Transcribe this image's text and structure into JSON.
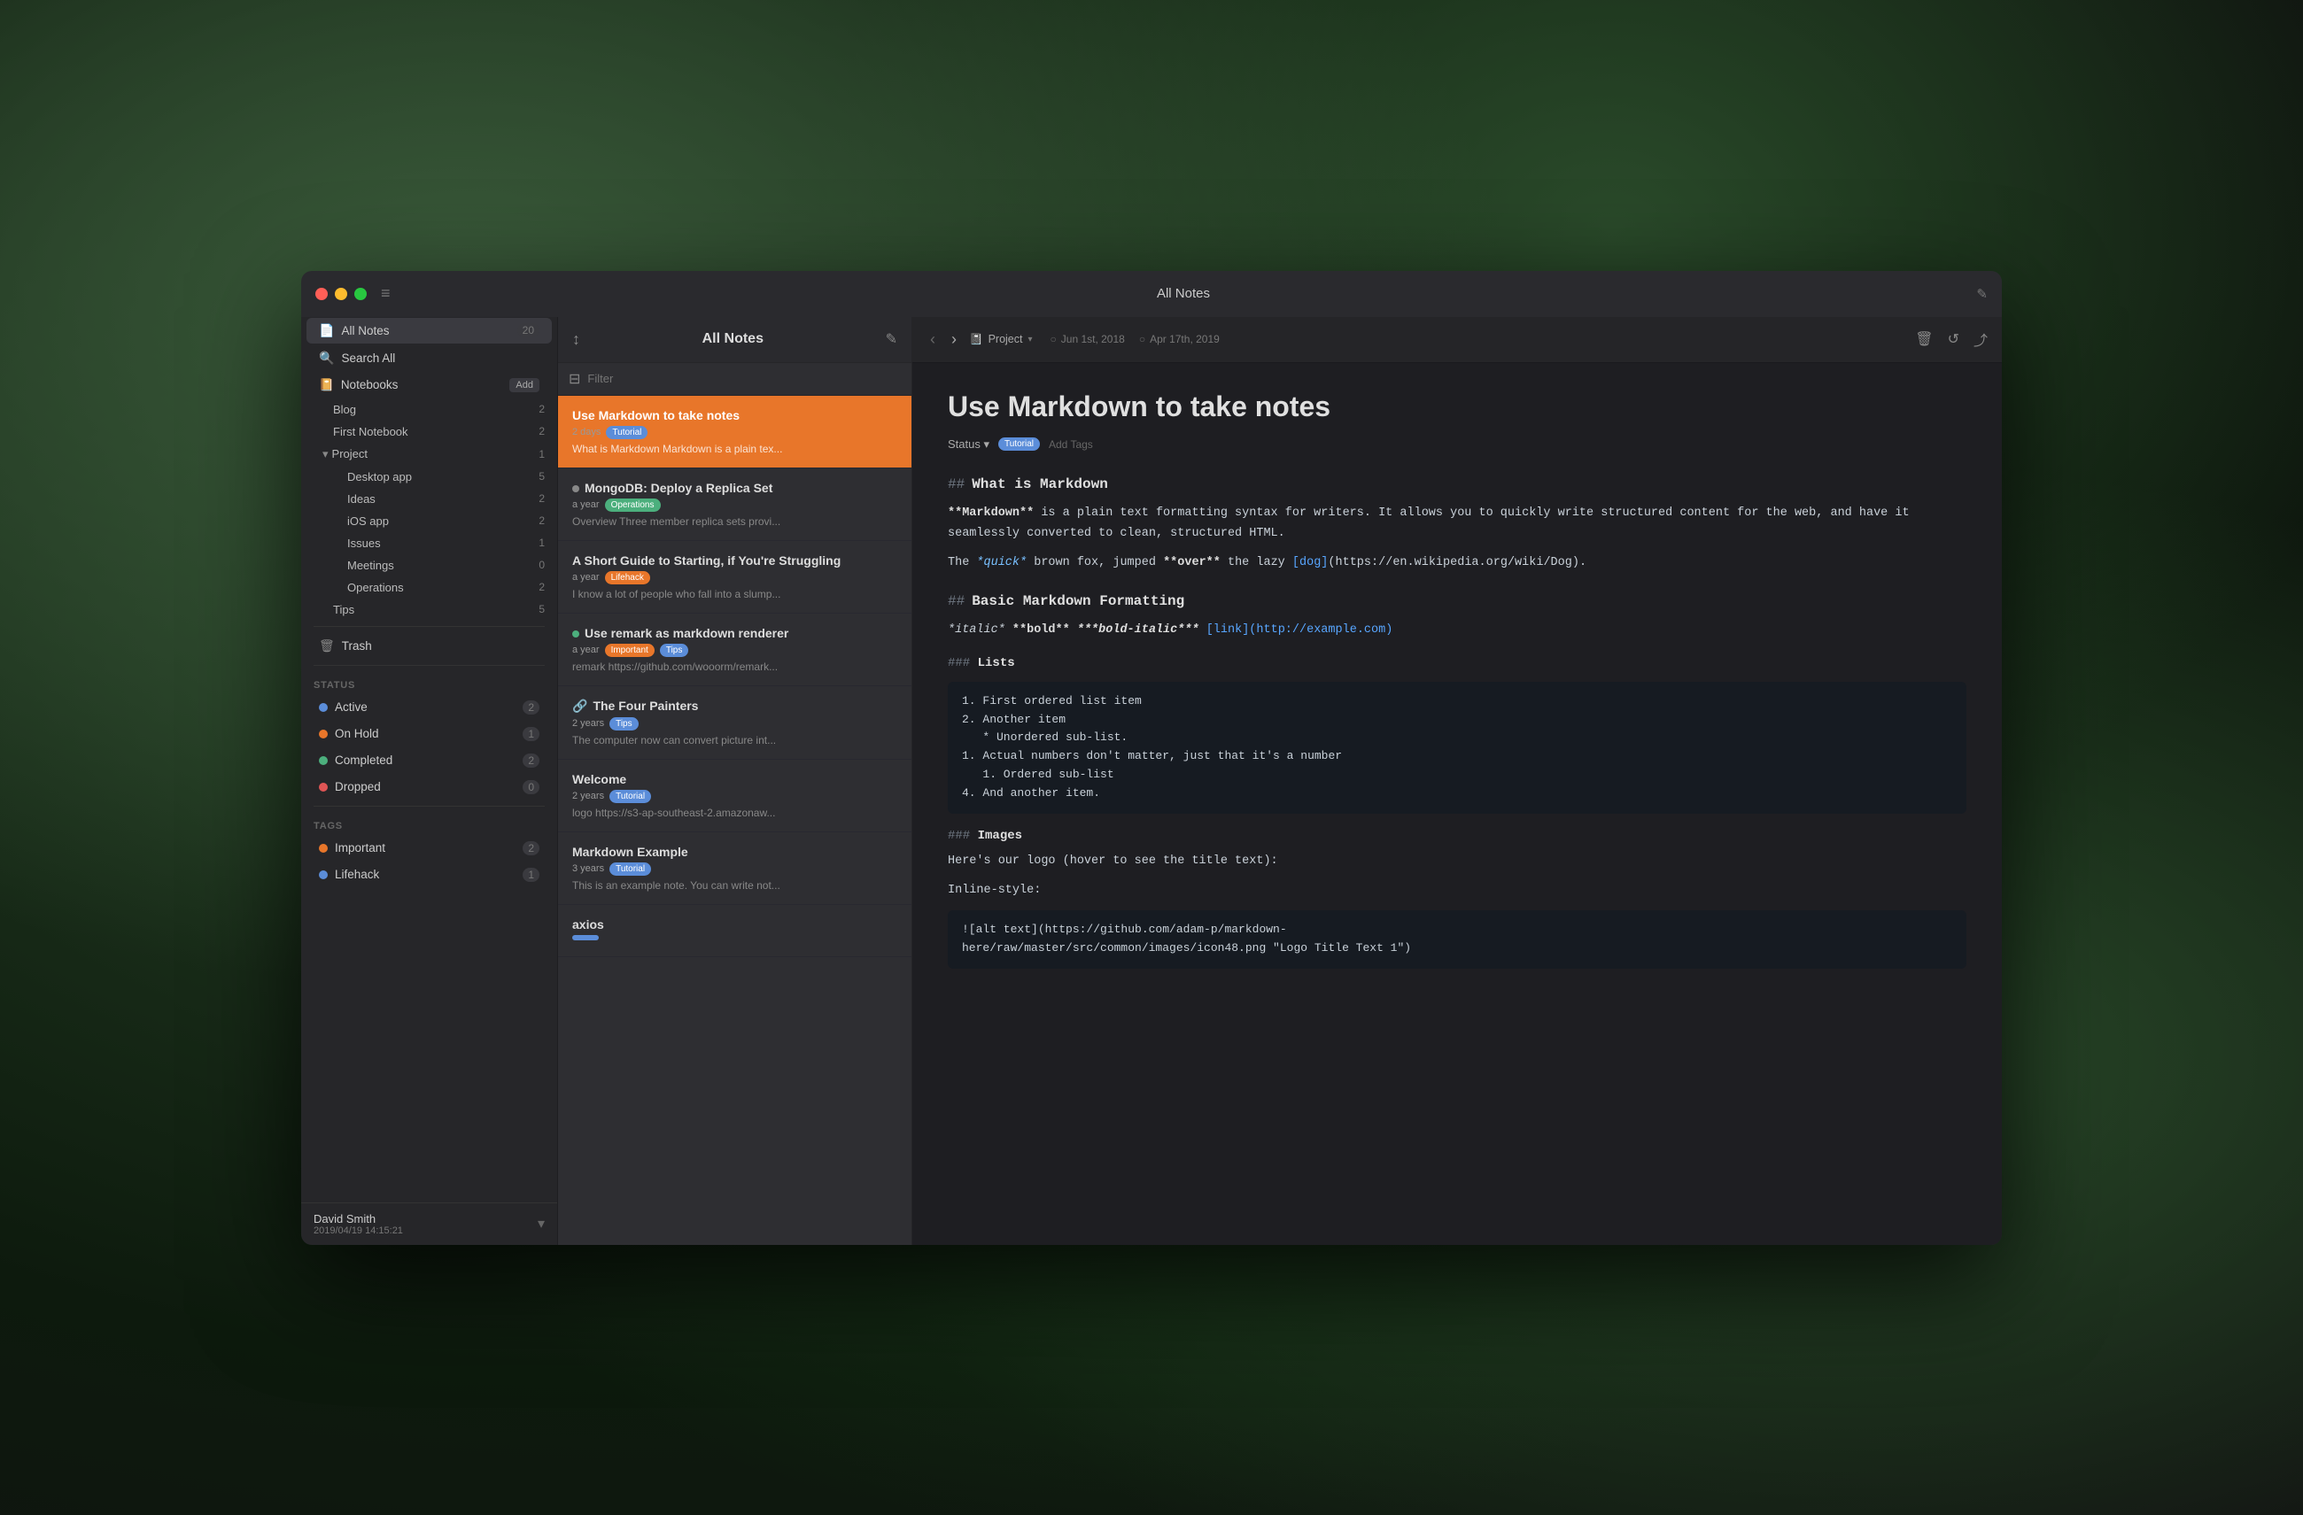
{
  "window": {
    "title": "All Notes",
    "traffic_lights": [
      "red",
      "yellow",
      "green"
    ]
  },
  "sidebar": {
    "all_notes_label": "All Notes",
    "all_notes_count": "20",
    "search_label": "Search All",
    "notebooks_label": "Notebooks",
    "notebooks_add": "Add",
    "notebooks_items": [
      {
        "label": "Blog",
        "count": "2"
      },
      {
        "label": "First Notebook",
        "count": "2"
      },
      {
        "label": "Project",
        "count": "1",
        "expanded": true,
        "children": [
          {
            "label": "Desktop app",
            "count": "5"
          },
          {
            "label": "Ideas",
            "count": "2"
          },
          {
            "label": "iOS app",
            "count": "2"
          },
          {
            "label": "Issues",
            "count": "1"
          },
          {
            "label": "Meetings",
            "count": "0"
          },
          {
            "label": "Operations",
            "count": "2"
          }
        ]
      },
      {
        "label": "Tips",
        "count": "5"
      }
    ],
    "trash_label": "Trash",
    "status_label": "Status",
    "status_items": [
      {
        "label": "Active",
        "count": "2",
        "color": "#5b8dd9"
      },
      {
        "label": "On Hold",
        "count": "1",
        "color": "#e8762a"
      },
      {
        "label": "Completed",
        "count": "2",
        "color": "#4caf7d"
      },
      {
        "label": "Dropped",
        "count": "0",
        "color": "#e05555"
      }
    ],
    "tags_label": "Tags",
    "tags_items": [
      {
        "label": "Important",
        "count": "2",
        "color": "#e8762a"
      },
      {
        "label": "Lifehack",
        "count": "1",
        "color": "#5b8dd9"
      }
    ],
    "user_name": "David Smith",
    "user_date": "2019/04/19 14:15:21"
  },
  "note_list": {
    "title": "All Notes",
    "filter_placeholder": "Filter",
    "sort_icon": "sort",
    "compose_icon": "compose",
    "notes": [
      {
        "id": 1,
        "title": "Use Markdown to take notes",
        "age": "2 days",
        "tags": [
          "Tutorial"
        ],
        "preview": "What is Markdown Markdown is a plain tex...",
        "selected": true
      },
      {
        "id": 2,
        "title": "MongoDB: Deploy a Replica Set",
        "age": "a year",
        "tags": [
          "Operations"
        ],
        "preview": "Overview Three member replica sets provi...",
        "icon_type": "circle",
        "selected": false
      },
      {
        "id": 3,
        "title": "A Short Guide to Starting, if You're Struggling",
        "age": "a year",
        "tags": [
          "Lifehack"
        ],
        "preview": "I know a lot of people who fall into a slump...",
        "selected": false
      },
      {
        "id": 4,
        "title": "Use remark as markdown renderer",
        "age": "a year",
        "tags": [
          "Important",
          "Tips"
        ],
        "preview": "remark https://github.com/wooorm/remark...",
        "icon_type": "check",
        "selected": false
      },
      {
        "id": 5,
        "title": "The Four Painters",
        "age": "2 years",
        "tags": [
          "Tips"
        ],
        "preview": "The computer now can convert picture int...",
        "icon_type": "link",
        "selected": false
      },
      {
        "id": 6,
        "title": "Welcome",
        "age": "2 years",
        "tags": [
          "Tutorial"
        ],
        "preview": "logo https://s3-ap-southeast-2.amazonaw...",
        "selected": false
      },
      {
        "id": 7,
        "title": "Markdown Example",
        "age": "3 years",
        "tags": [
          "Tutorial"
        ],
        "preview": "This is an example note. You can write not...",
        "selected": false
      },
      {
        "id": 8,
        "title": "axios",
        "age": "",
        "tags": [],
        "preview": "",
        "selected": false
      }
    ]
  },
  "editor": {
    "breadcrumb_icon": "📓",
    "breadcrumb_notebook": "Project",
    "date_created_icon": "🕐",
    "date_created": "Jun 1st, 2018",
    "date_modified_icon": "📅",
    "date_modified": "Apr 17th, 2019",
    "note_title": "Use Markdown to take notes",
    "status_label": "Status",
    "status_value": "Tutorial",
    "add_tags_label": "Add Tags",
    "content": {
      "h2_what": "What is Markdown",
      "p1": "**Markdown** is a plain text formatting syntax for writers. It allows you to quickly write structured content for the web, and have it seamlessly converted to clean, structured HTML.",
      "p2": "The *quick* brown fox, jumped **over** the lazy [dog](https://en.wikipedia.org/wiki/Dog).",
      "h2_basic": "Basic Markdown Formatting",
      "p3": "*italic* **bold** ***bold-italic*** [link](http://example.com)",
      "h3_lists": "Lists",
      "list_items": [
        "First ordered list item",
        "Another item",
        "* Unordered sub-list.",
        "Actual numbers don't matter, just that it's a number",
        "1. Ordered sub-list",
        "And another item."
      ],
      "h3_images": "Images",
      "p4": "Here's our logo (hover to see the title text):",
      "p5": "Inline-style:",
      "p6": "![alt text](https://github.com/adam-p/markdown-here/raw/master/src/common/images/icon48.png \"Logo Title Text 1\")"
    }
  },
  "icons": {
    "sort": "≡",
    "compose": "✏",
    "filter": "⊟",
    "trash": "🗑",
    "chevron_down": "▾",
    "chevron_left": "‹",
    "chevron_right": "›",
    "notebook": "📓",
    "search": "🔍",
    "clock": "○",
    "calendar": "○",
    "delete": "🗑",
    "history": "↺",
    "share": "⤴",
    "hamburger": "≡",
    "tag": "🏷",
    "status": "◉",
    "active_dot_color": "#5b8dd9",
    "onhold_dot_color": "#e8762a",
    "completed_dot_color": "#4caf7d",
    "dropped_dot_color": "#e05555"
  }
}
